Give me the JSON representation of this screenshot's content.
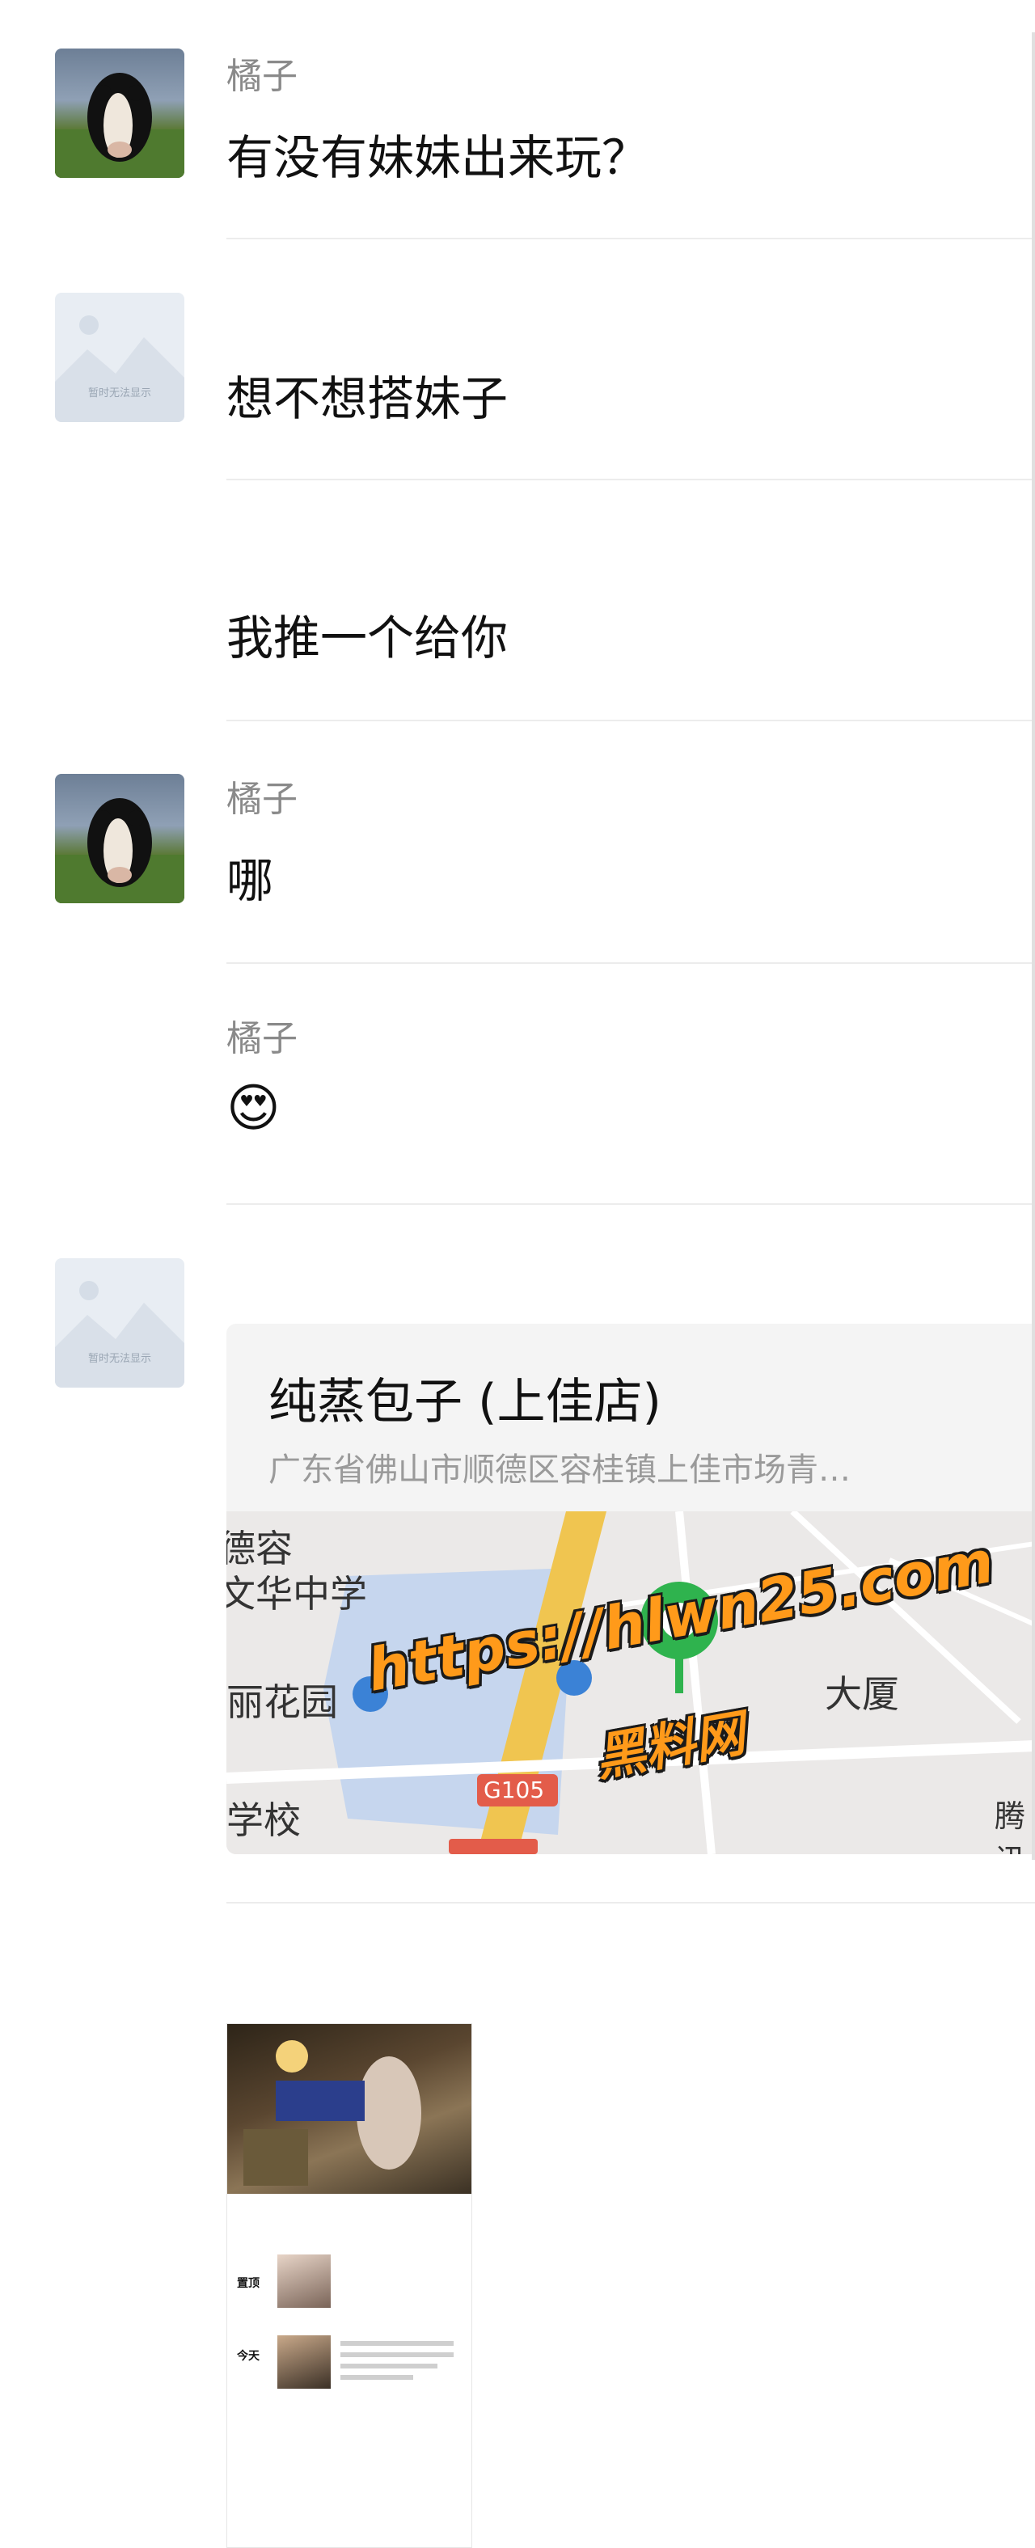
{
  "messages": [
    {
      "sender": "橘子",
      "text": "有没有妹妹出来玩？"
    },
    {
      "text": "想不想搭妹子"
    },
    {
      "text": "我推一个给你"
    },
    {
      "sender": "橘子",
      "text": "哪"
    },
    {
      "sender": "橘子",
      "emoji": "😍"
    }
  ],
  "placeholder_avatar_text": "暂时无法显示",
  "location": {
    "name": "纯蒸包子 (上佳店)",
    "address": "广东省佛山市顺德区容桂镇上佳市场青…",
    "map_labels": {
      "school1_a": "德容",
      "school1_b": "文华中学",
      "garden": "丽花园",
      "building": "大厦",
      "school2": "学校",
      "road": "G105",
      "brand": "腾讯"
    }
  },
  "watermark": {
    "url": "https://hlwn25.com",
    "name": "黑料网"
  },
  "shared_post": {
    "label_pinned": "置顶",
    "label_today": "今天"
  },
  "colors": {
    "map_pin": "#2fb34e",
    "watermark": "#ff9a1a",
    "road": "#f0c550"
  }
}
